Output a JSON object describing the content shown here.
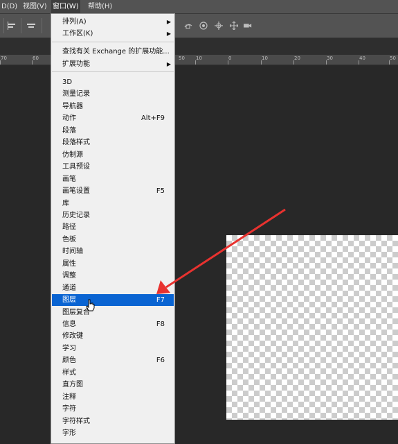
{
  "menubar": {
    "items": [
      "D(D)",
      "视图(V)",
      "窗口(W)",
      "帮助(H)"
    ]
  },
  "toolbar": {
    "left_icons": [
      "align-left-icon",
      "align-center-icon"
    ],
    "right_icons": [
      "orbit-3d-icon",
      "roll-3d-icon",
      "pan-3d-icon",
      "slide-3d-icon",
      "camera-3d-icon"
    ]
  },
  "ruler": {
    "labels": [
      "70",
      "60",
      "50",
      "10",
      "0",
      "10",
      "20",
      "30",
      "40",
      "50"
    ]
  },
  "menu": {
    "top": [
      {
        "label": "排列(A)",
        "submenu": true
      },
      {
        "label": "工作区(K)",
        "submenu": true
      }
    ],
    "extensions": [
      {
        "label": "查找有关 Exchange 的扩展功能...",
        "submenu": false
      },
      {
        "label": "扩展功能",
        "submenu": true
      }
    ],
    "panels": [
      {
        "label": "3D",
        "shortcut": ""
      },
      {
        "label": "测量记录",
        "shortcut": ""
      },
      {
        "label": "导航器",
        "shortcut": ""
      },
      {
        "label": "动作",
        "shortcut": "Alt+F9"
      },
      {
        "label": "段落",
        "shortcut": ""
      },
      {
        "label": "段落样式",
        "shortcut": ""
      },
      {
        "label": "仿制源",
        "shortcut": ""
      },
      {
        "label": "工具预设",
        "shortcut": ""
      },
      {
        "label": "画笔",
        "shortcut": ""
      },
      {
        "label": "画笔设置",
        "shortcut": "F5"
      },
      {
        "label": "库",
        "shortcut": ""
      },
      {
        "label": "历史记录",
        "shortcut": ""
      },
      {
        "label": "路径",
        "shortcut": ""
      },
      {
        "label": "色板",
        "shortcut": ""
      },
      {
        "label": "时间轴",
        "shortcut": ""
      },
      {
        "label": "属性",
        "shortcut": ""
      },
      {
        "label": "调整",
        "shortcut": ""
      },
      {
        "label": "通道",
        "shortcut": ""
      },
      {
        "label": "图层",
        "shortcut": "F7"
      },
      {
        "label": "图层复合",
        "shortcut": ""
      },
      {
        "label": "信息",
        "shortcut": "F8"
      },
      {
        "label": "修改键",
        "shortcut": ""
      },
      {
        "label": "学习",
        "shortcut": ""
      },
      {
        "label": "颜色",
        "shortcut": "F6"
      },
      {
        "label": "样式",
        "shortcut": ""
      },
      {
        "label": "直方图",
        "shortcut": ""
      },
      {
        "label": "注释",
        "shortcut": ""
      },
      {
        "label": "字符",
        "shortcut": ""
      },
      {
        "label": "字符样式",
        "shortcut": ""
      },
      {
        "label": "字形",
        "shortcut": ""
      }
    ],
    "selected_label": "图层"
  },
  "colors": {
    "menu_highlight": "#0a64d2",
    "annotation_arrow": "#e8322f",
    "app_background": "#282828",
    "toolbar": "#535353"
  }
}
